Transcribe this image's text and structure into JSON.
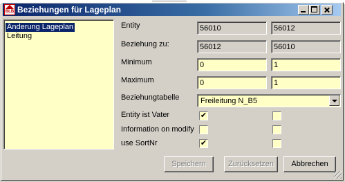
{
  "window": {
    "title": "Beziehungen für Lageplan",
    "icon_text": "BLB"
  },
  "list": {
    "items": [
      {
        "label": "Änderung Lageplan",
        "selected": true
      },
      {
        "label": "Leitung",
        "selected": false
      }
    ]
  },
  "form": {
    "entity_label": "Entity",
    "entity_values": [
      "56010",
      "56012"
    ],
    "beziehung_label": "Beziehung zu:",
    "beziehung_values": [
      "56012",
      "56010"
    ],
    "minimum_label": "Minimum",
    "minimum_values": [
      "0",
      "1"
    ],
    "maximum_label": "Maximum",
    "maximum_values": [
      "0",
      "1"
    ],
    "tabelle_label": "Beziehungtabelle",
    "tabelle_value": "Freileitung N_B5",
    "checks": [
      {
        "label": "Entity ist Vater",
        "values": [
          true,
          false
        ]
      },
      {
        "label": "Information on modify",
        "values": [
          false,
          false
        ]
      },
      {
        "label": "use SortNr",
        "values": [
          true,
          false
        ]
      }
    ]
  },
  "buttons": {
    "save": "Speichern",
    "reset": "Zurücksetzen",
    "cancel": "Abbrechen"
  },
  "colors": {
    "editable_bg": "#ffffc6",
    "selection_bg": "#0a246a",
    "face": "#d4d0c8"
  }
}
